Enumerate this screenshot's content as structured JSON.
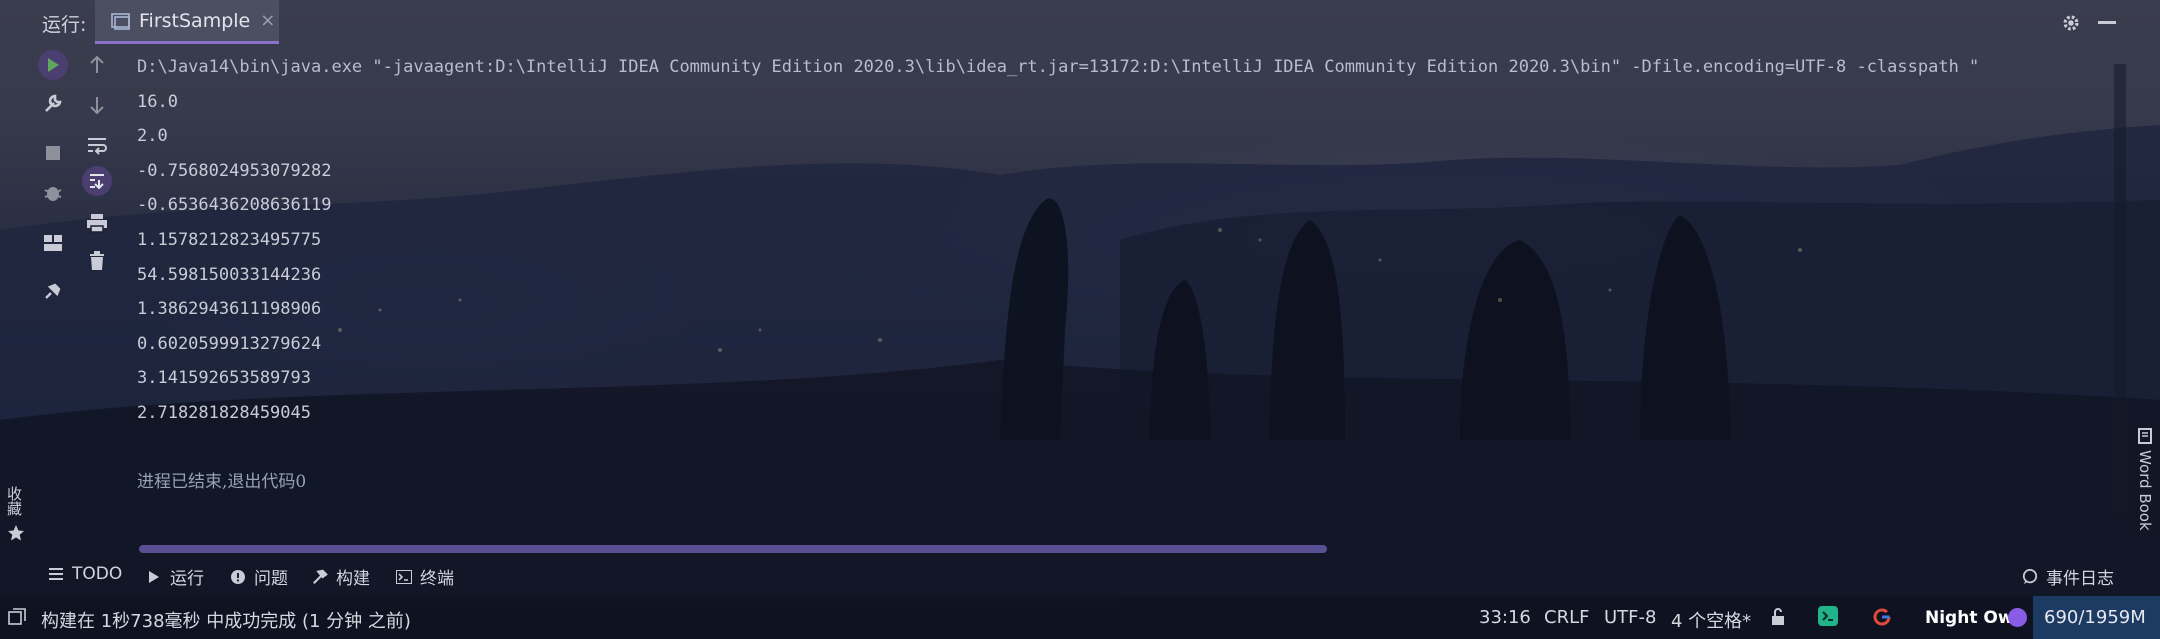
{
  "topbar": {
    "run_label": "运行:",
    "tab_label": "FirstSample",
    "tab_close": "×"
  },
  "console": {
    "command": "D:\\Java14\\bin\\java.exe \"-javaagent:D:\\IntelliJ IDEA Community Edition 2020.3\\lib\\idea_rt.jar=13172:D:\\IntelliJ IDEA Community Edition 2020.3\\bin\" -Dfile.encoding=UTF-8 -classpath \"",
    "output": [
      "16.0",
      "2.0",
      "-0.7568024953079282",
      "-0.6536436208636119",
      "1.1578212823495775",
      "54.598150033144236",
      "1.3862943611198906",
      "0.6020599913279624",
      "3.141592653589793",
      "2.718281828459045"
    ],
    "exit_message": "进程已结束,退出代码0"
  },
  "tooltabs": {
    "todo": "TODO",
    "run": "运行",
    "problems": "问题",
    "build": "构建",
    "terminal": "终端",
    "event_log": "事件日志"
  },
  "side": {
    "favorites": "收藏",
    "wordbook": "Word Book"
  },
  "statusbar": {
    "message": "构建在 1秒738毫秒 中成功完成 (1 分钟 之前)",
    "position": "33:16",
    "line_sep": "CRLF",
    "encoding": "UTF-8",
    "indent": "4 个空格*",
    "theme": "Night Owl",
    "memory": "690/1959M"
  },
  "colors": {
    "accent": "#8a72c9",
    "run_green": "#5ea55f",
    "scroll_thumb": "#5a4f95",
    "memory_bg": "#1d3a63"
  }
}
